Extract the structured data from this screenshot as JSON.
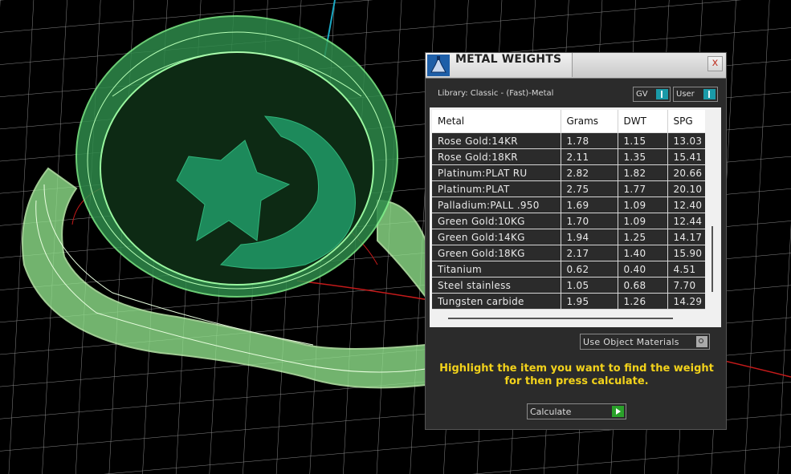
{
  "window": {
    "title": "METAL WEIGHTS",
    "close_label": "x",
    "library_label": "Library: Classic - (Fast)-Metal",
    "gv_label": "GV",
    "user_label": "User"
  },
  "table": {
    "headers": [
      "Metal",
      "Grams",
      "DWT",
      "SPG"
    ],
    "rows": [
      [
        "Rose Gold:14KR",
        "1.78",
        "1.15",
        "13.03"
      ],
      [
        "Rose Gold:18KR",
        "2.11",
        "1.35",
        "15.41"
      ],
      [
        "Platinum:PLAT RU",
        "2.82",
        "1.82",
        "20.66"
      ],
      [
        "Platinum:PLAT",
        "2.75",
        "1.77",
        "20.10"
      ],
      [
        "Palladium:PALL .950",
        "1.69",
        "1.09",
        "12.40"
      ],
      [
        "Green Gold:10KG",
        "1.70",
        "1.09",
        "12.44"
      ],
      [
        "Green Gold:14KG",
        "1.94",
        "1.25",
        "14.17"
      ],
      [
        "Green Gold:18KG",
        "2.17",
        "1.40",
        "15.90"
      ],
      [
        "Titanium",
        "0.62",
        "0.40",
        "4.51"
      ],
      [
        "Steel stainless",
        "1.05",
        "0.68",
        "7.70"
      ],
      [
        "Tungsten carbide",
        "1.95",
        "1.26",
        "14.29"
      ]
    ]
  },
  "options": {
    "use_object_materials": "Use Object Materials"
  },
  "hint": {
    "line1": "Highlight the item you want to find the weight",
    "line2": "for then press calculate."
  },
  "buttons": {
    "calculate": "Calculate"
  },
  "colors": {
    "panel_bg": "#2b2b2b",
    "hint": "#f2d21b",
    "wireframe": "#5be36a",
    "knob": "#1a9aa8"
  },
  "icons": {
    "app": "metal-weights-icon",
    "close": "close-icon",
    "calculate": "play-icon"
  }
}
